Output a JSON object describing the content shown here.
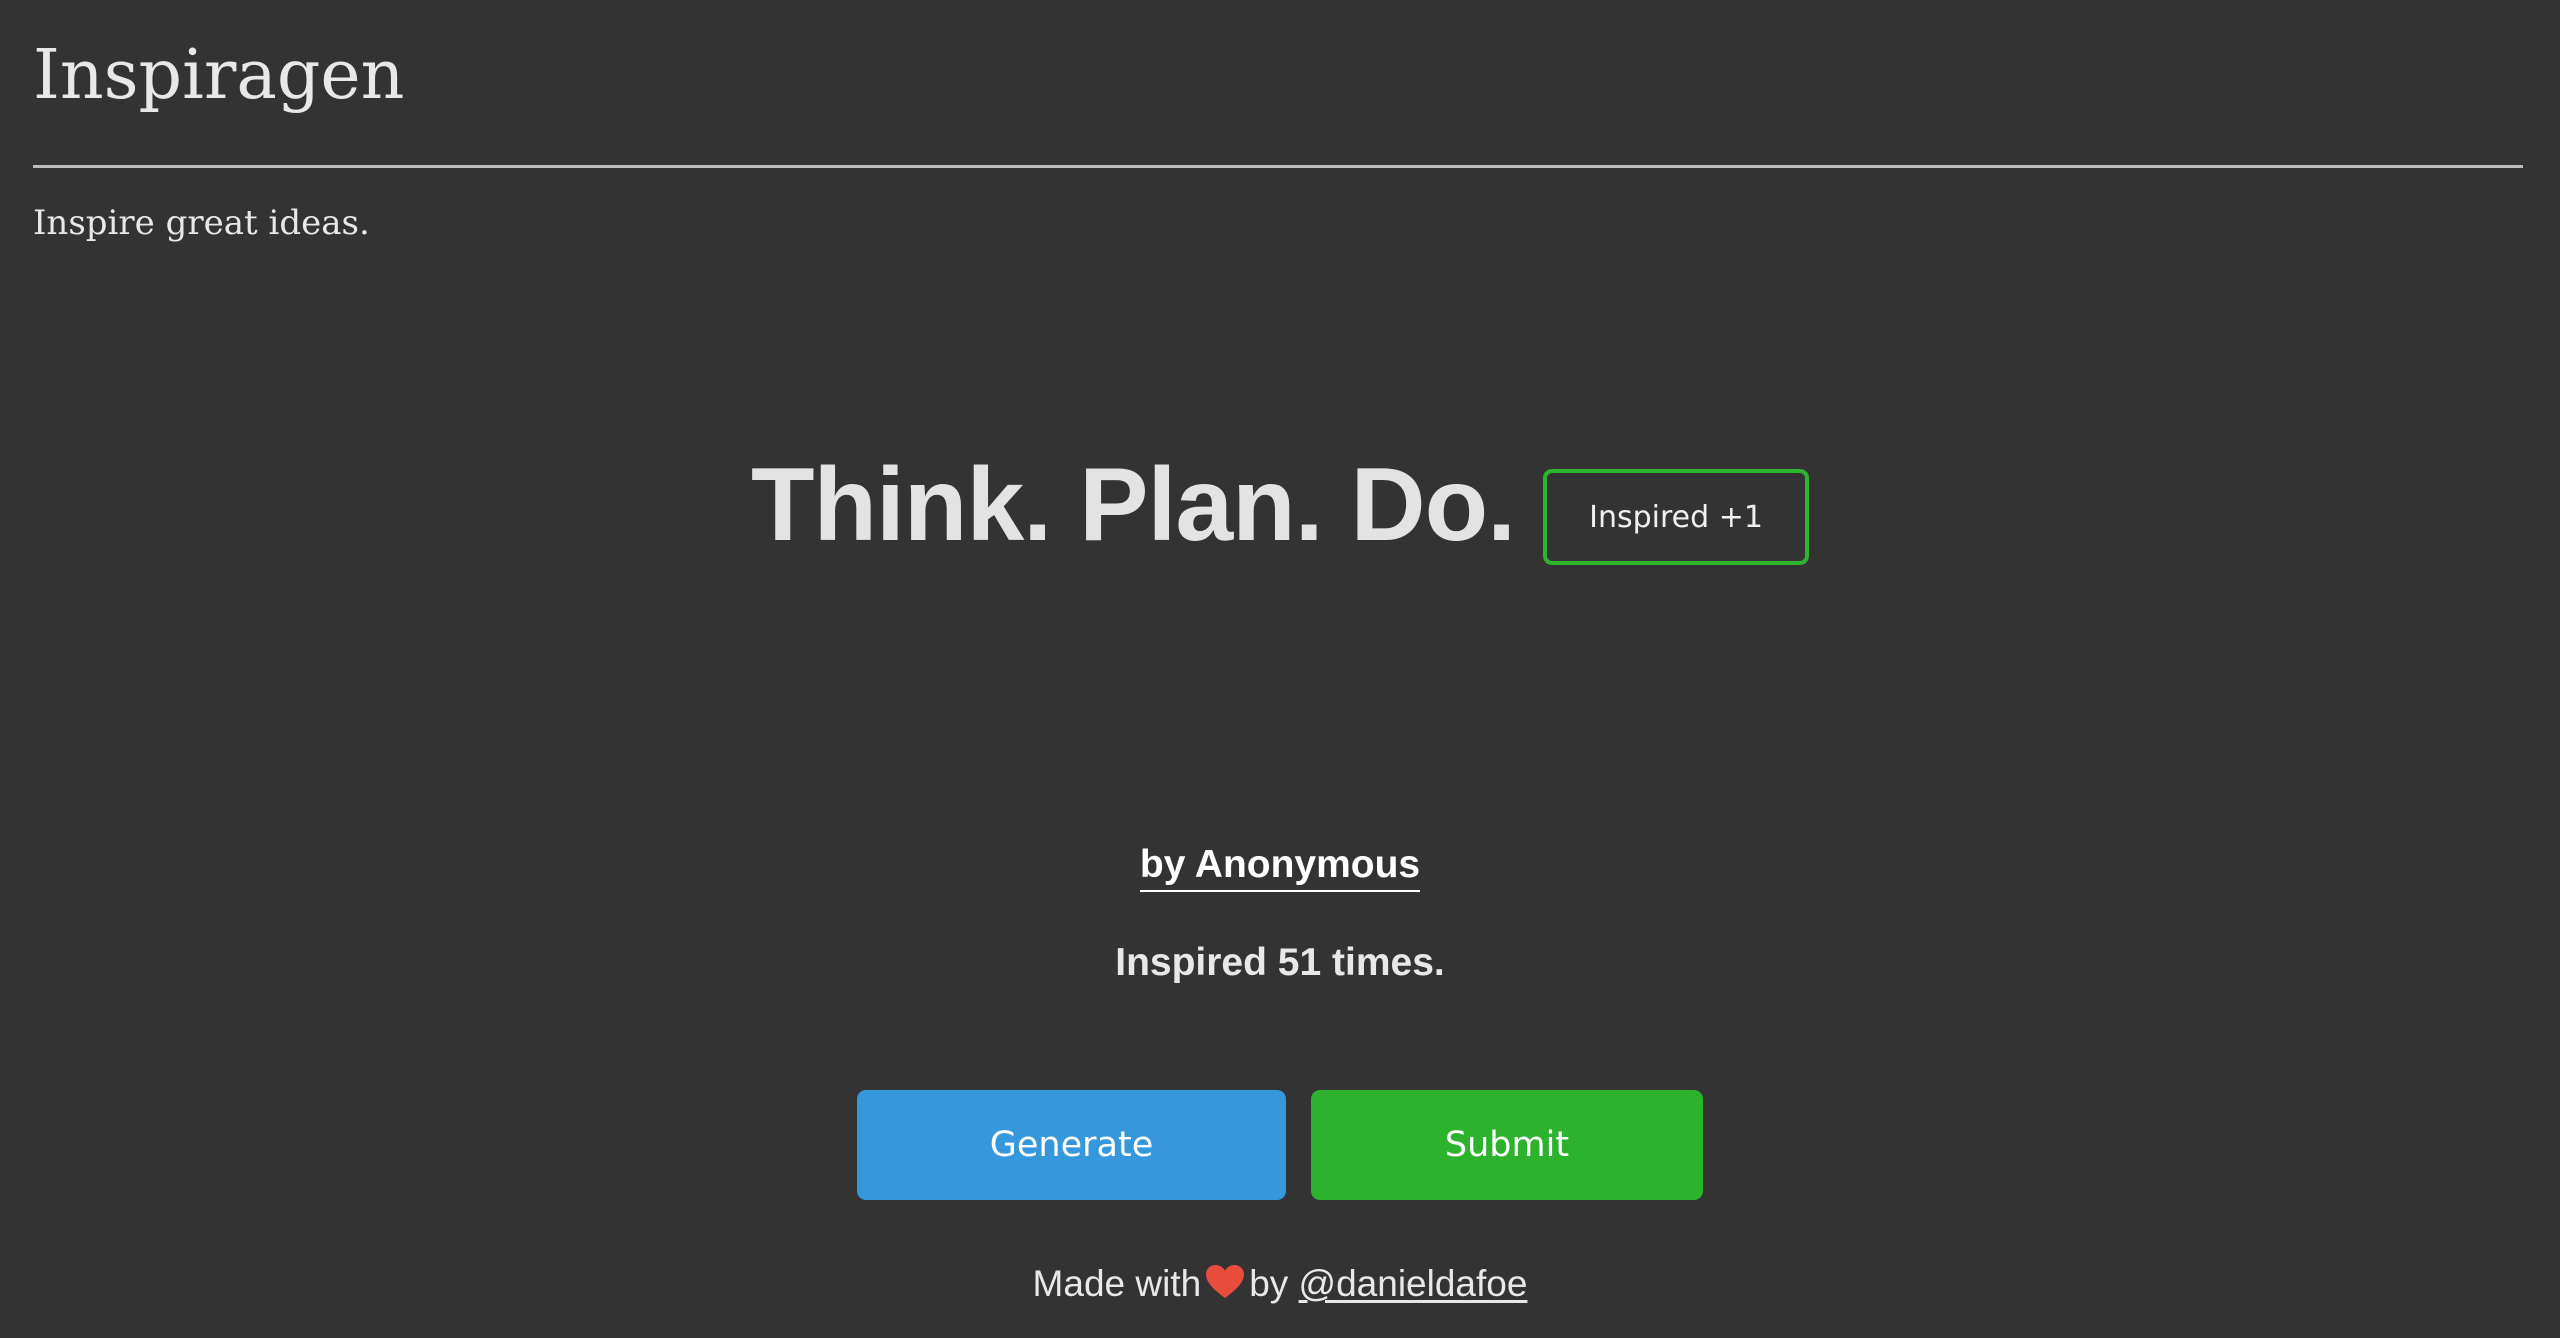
{
  "header": {
    "title": "Inspiragen",
    "tagline": "Inspire great ideas."
  },
  "quote": {
    "text": "Think. Plan. Do.",
    "inspired_button": "Inspired +1"
  },
  "author": {
    "label": "by Anonymous"
  },
  "stats": {
    "prefix": "Inspired ",
    "count": "51",
    "suffix": " times."
  },
  "actions": {
    "generate_label": "Generate",
    "submit_label": "Submit"
  },
  "footer": {
    "made_with": "Made with",
    "heart_icon": "heart-icon",
    "by": "by",
    "handle": "@danieldafoe"
  },
  "colors": {
    "background": "#333333",
    "generate": "#3598dc",
    "submit": "#2cb22c",
    "inspired_border": "#2db52d",
    "heart": "#e74c3c"
  }
}
